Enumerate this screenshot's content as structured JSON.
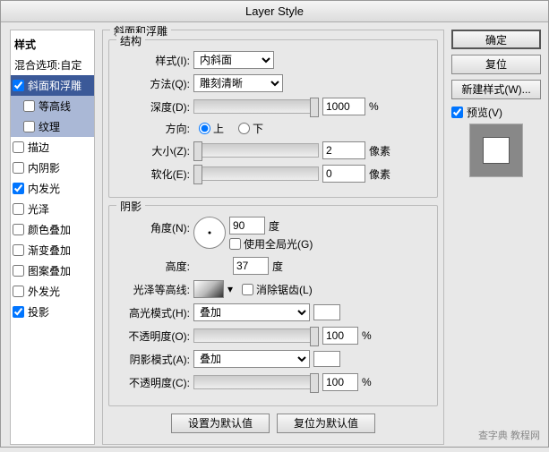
{
  "window": {
    "title": "Layer Style"
  },
  "sidebar": {
    "header": "样式",
    "default_option": "混合选项:自定",
    "items": [
      {
        "label": "斜面和浮雕",
        "checked": true,
        "selected": true
      },
      {
        "label": "等高线",
        "checked": false,
        "sub": true
      },
      {
        "label": "纹理",
        "checked": false,
        "sub": true
      },
      {
        "label": "描边",
        "checked": false
      },
      {
        "label": "内阴影",
        "checked": false
      },
      {
        "label": "内发光",
        "checked": true
      },
      {
        "label": "光泽",
        "checked": false
      },
      {
        "label": "颜色叠加",
        "checked": false
      },
      {
        "label": "渐变叠加",
        "checked": false
      },
      {
        "label": "图案叠加",
        "checked": false
      },
      {
        "label": "外发光",
        "checked": false
      },
      {
        "label": "投影",
        "checked": true
      }
    ]
  },
  "panel_title": "斜面和浮雕",
  "structure": {
    "legend": "结构",
    "style_label": "样式(I):",
    "style_value": "内斜面",
    "technique_label": "方法(Q):",
    "technique_value": "雕刻清晰",
    "depth_label": "深度(D):",
    "depth_value": "1000",
    "depth_unit": "%",
    "direction_label": "方向:",
    "up": "上",
    "down": "下",
    "size_label": "大小(Z):",
    "size_value": "2",
    "size_unit": "像素",
    "soften_label": "软化(E):",
    "soften_value": "0",
    "soften_unit": "像素"
  },
  "shading": {
    "legend": "阴影",
    "angle_label": "角度(N):",
    "angle_value": "90",
    "angle_unit": "度",
    "global_light": "使用全局光(G)",
    "altitude_label": "高度:",
    "altitude_value": "37",
    "altitude_unit": "度",
    "gloss_label": "光泽等高线:",
    "antialias": "消除锯齿(L)",
    "highlight_mode_label": "高光模式(H):",
    "highlight_mode_value": "叠加",
    "highlight_opacity_label": "不透明度(O):",
    "highlight_opacity_value": "100",
    "opacity_unit": "%",
    "shadow_mode_label": "阴影模式(A):",
    "shadow_mode_value": "叠加",
    "shadow_opacity_label": "不透明度(C):",
    "shadow_opacity_value": "100"
  },
  "footer": {
    "default": "设置为默认值",
    "reset": "复位为默认值"
  },
  "right": {
    "ok": "确定",
    "cancel": "复位",
    "new_style": "新建样式(W)...",
    "preview": "预览(V)"
  },
  "watermark": "查字典  教程网"
}
